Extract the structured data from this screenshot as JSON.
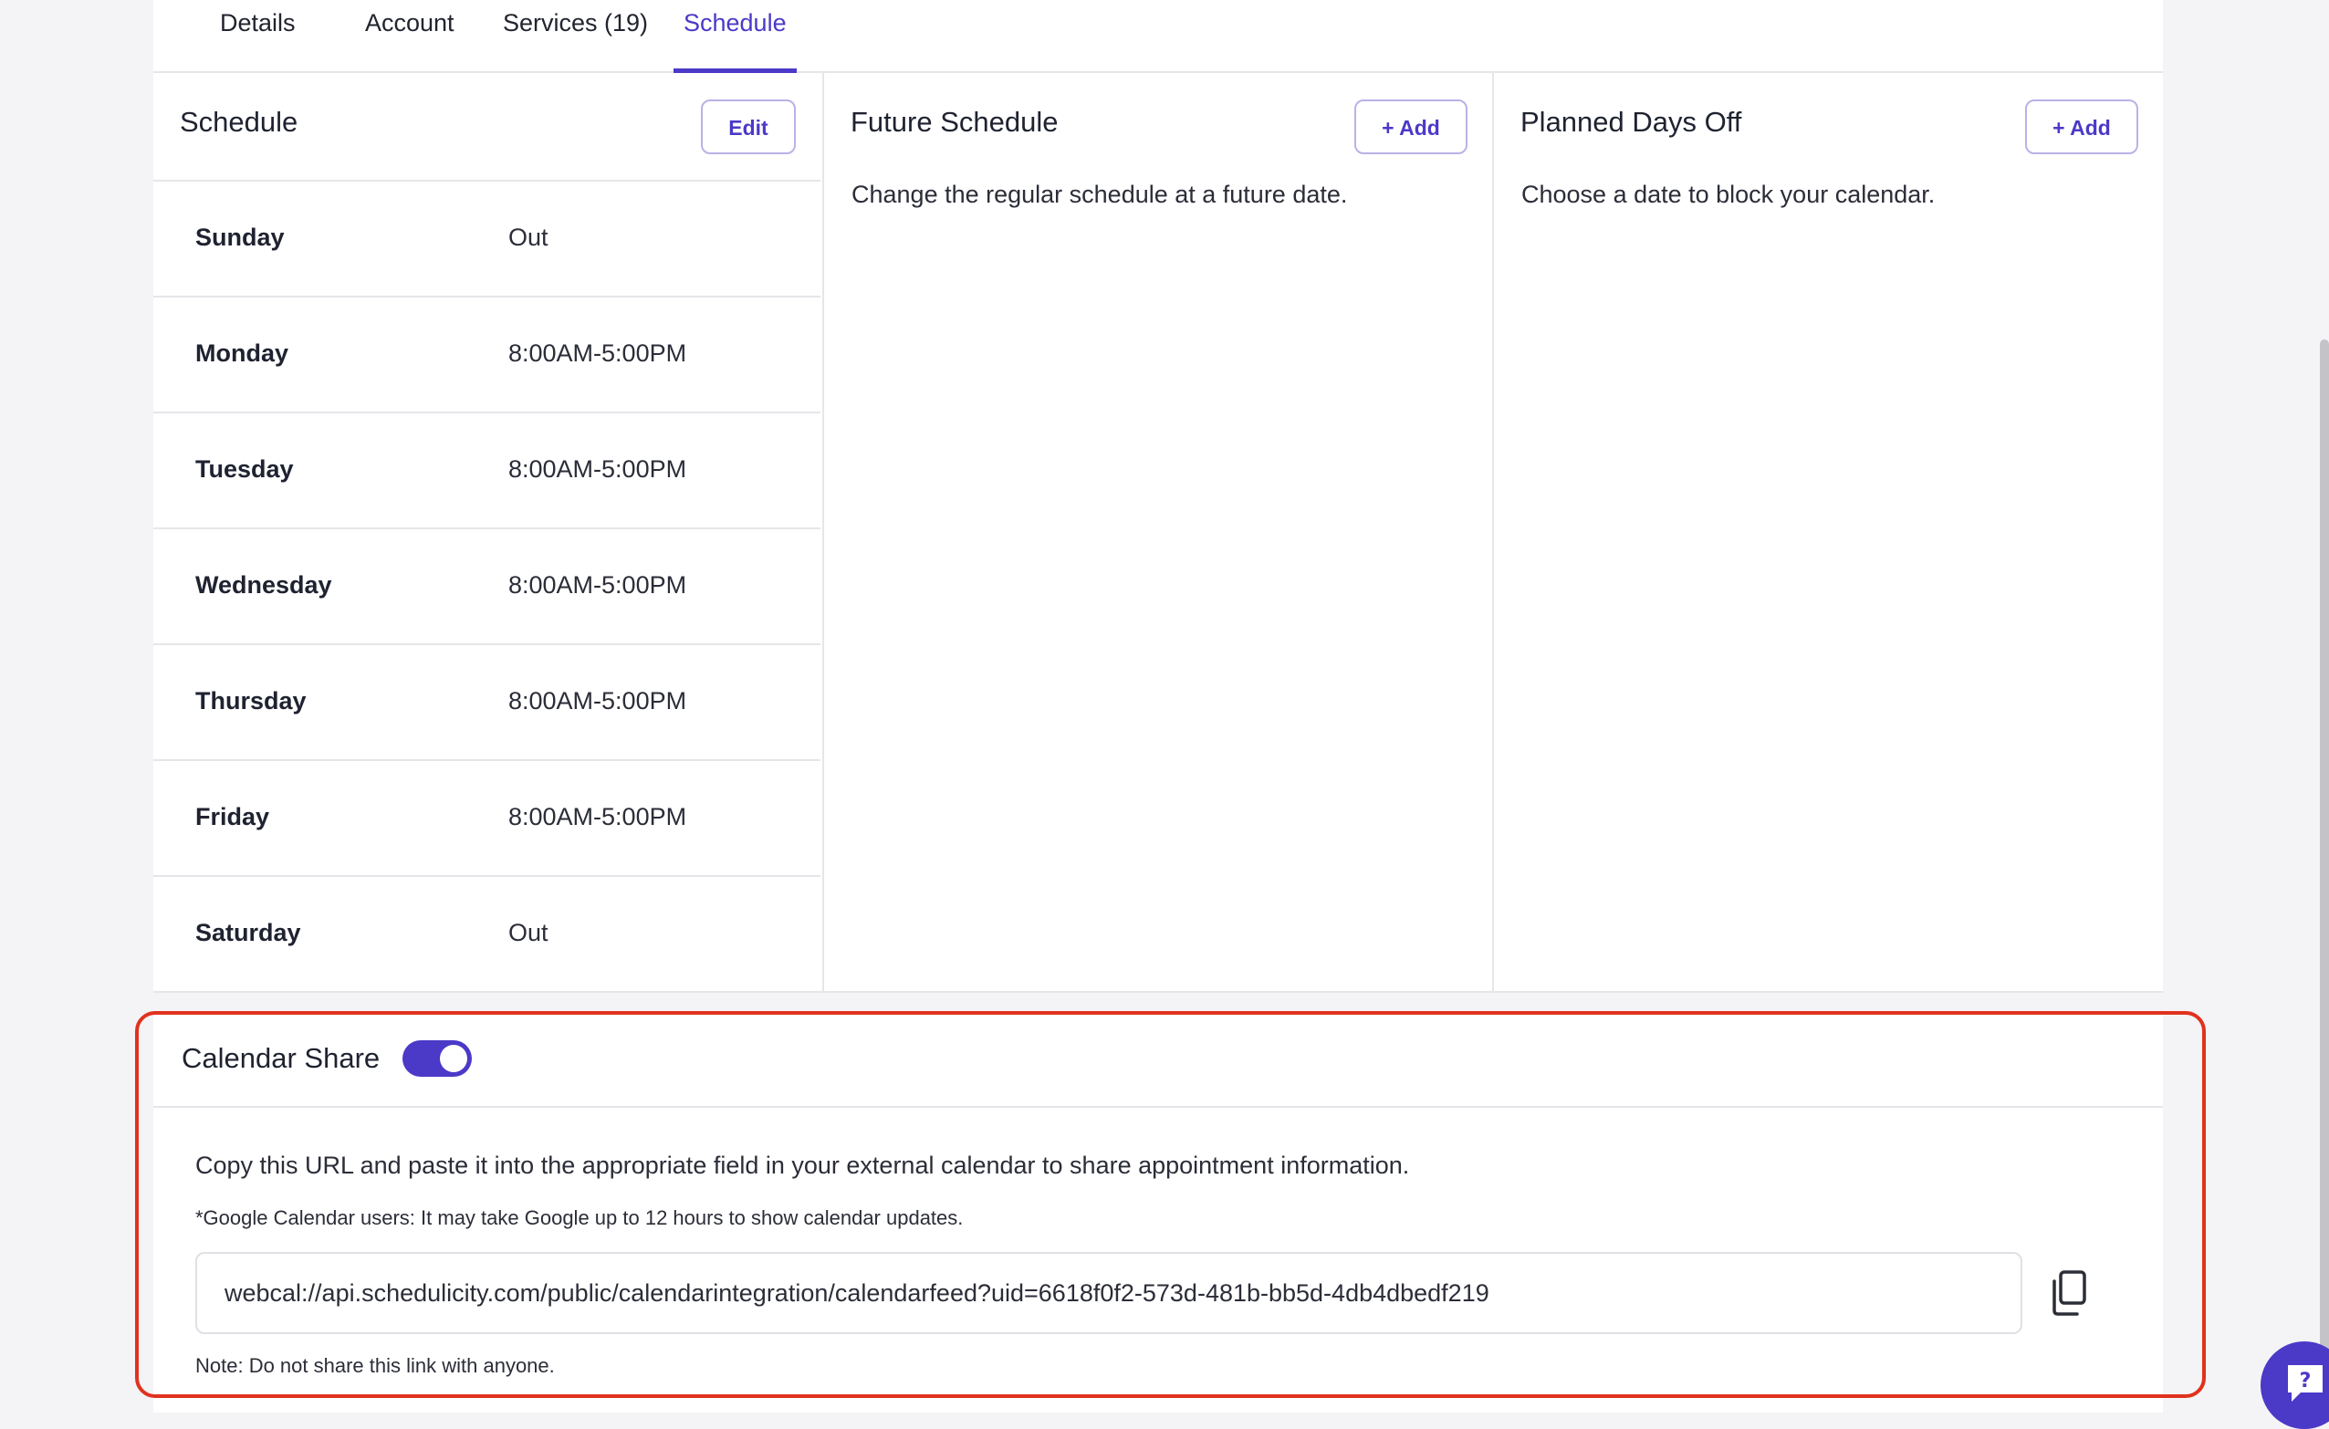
{
  "tabs": [
    {
      "label": "Details"
    },
    {
      "label": "Account"
    },
    {
      "label": "Services (19)"
    },
    {
      "label": "Schedule",
      "active": true
    }
  ],
  "schedule": {
    "title": "Schedule",
    "edit_label": "Edit",
    "days": [
      {
        "day": "Sunday",
        "hours": "Out"
      },
      {
        "day": "Monday",
        "hours": "8:00AM-5:00PM"
      },
      {
        "day": "Tuesday",
        "hours": "8:00AM-5:00PM"
      },
      {
        "day": "Wednesday",
        "hours": "8:00AM-5:00PM"
      },
      {
        "day": "Thursday",
        "hours": "8:00AM-5:00PM"
      },
      {
        "day": "Friday",
        "hours": "8:00AM-5:00PM"
      },
      {
        "day": "Saturday",
        "hours": "Out"
      }
    ]
  },
  "future_schedule": {
    "title": "Future Schedule",
    "add_label": "+ Add",
    "description": "Change the regular schedule at a future date."
  },
  "days_off": {
    "title": "Planned Days Off",
    "add_label": "+ Add",
    "description": "Choose a date to block your calendar."
  },
  "calendar_share": {
    "title": "Calendar Share",
    "enabled": true,
    "description": "Copy this URL and paste it into the appropriate field in your external calendar to share appointment information.",
    "google_note": "*Google Calendar users: It may take Google up to 12 hours to show calendar updates.",
    "url": "webcal://api.schedulicity.com/public/calendarintegration/calendarfeed?uid=6618f0f2-573d-481b-bb5d-4db4dbedf219",
    "note": "Note: Do not share this link with anyone."
  },
  "colors": {
    "accent": "#4b39c8",
    "highlight": "#e0321e"
  }
}
